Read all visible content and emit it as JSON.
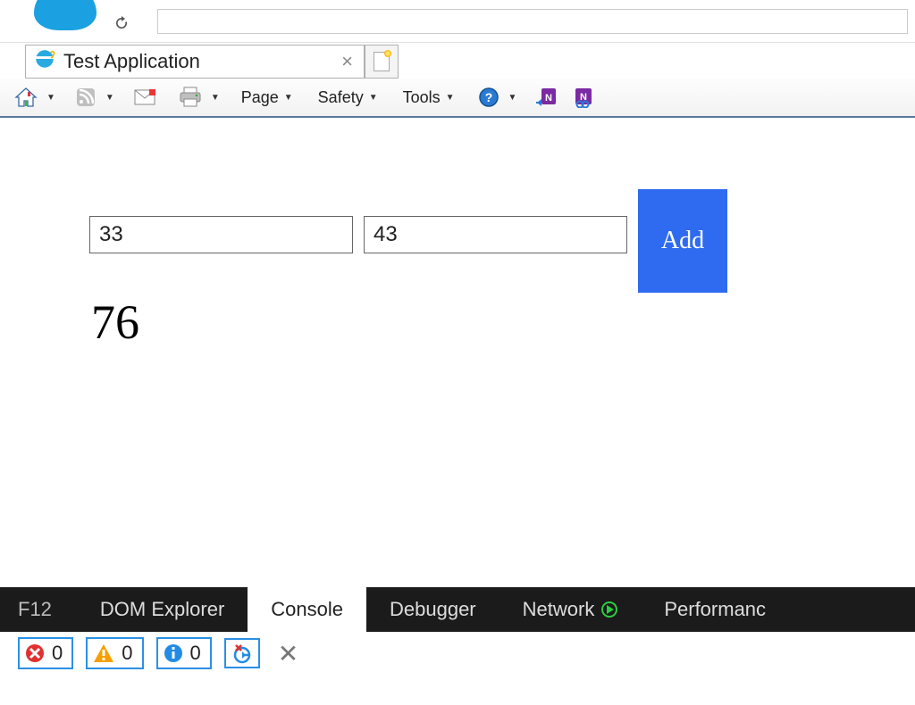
{
  "tab": {
    "title": "Test Application"
  },
  "toolbar": {
    "menus": {
      "page": "Page",
      "safety": "Safety",
      "tools": "Tools"
    }
  },
  "app": {
    "input1_value": "33",
    "input2_value": "43",
    "add_label": "Add",
    "result": "76"
  },
  "devtools": {
    "f12_label": "F12",
    "tabs": {
      "dom_explorer": "DOM Explorer",
      "console": "Console",
      "debugger": "Debugger",
      "network": "Network",
      "performance": "Performanc"
    },
    "counts": {
      "errors": "0",
      "warnings": "0",
      "info": "0"
    }
  }
}
